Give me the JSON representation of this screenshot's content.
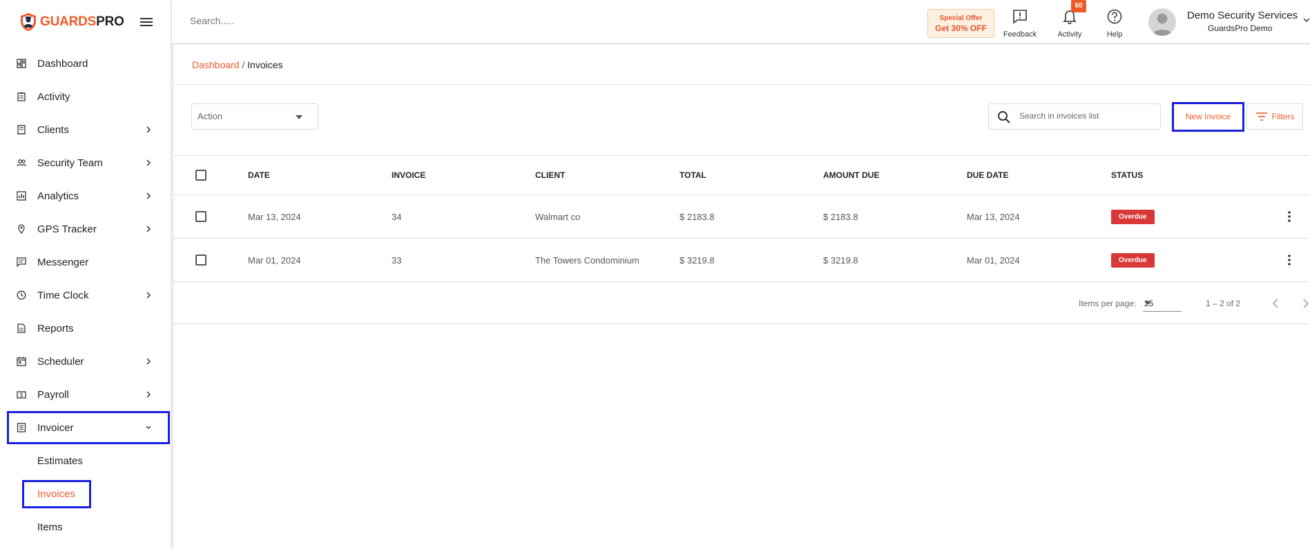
{
  "brand": {
    "part1": "GUARDS",
    "part2": "PRO"
  },
  "header": {
    "search_placeholder": "Search.....",
    "offer_line1": "Special Offer",
    "offer_line2": "Get 30% OFF",
    "feedback_label": "Feedback",
    "activity_label": "Activity",
    "activity_count": "60",
    "help_label": "Help",
    "user_name": "Demo Security Services",
    "user_org": "GuardsPro Demo"
  },
  "sidebar": {
    "items": [
      {
        "label": "Dashboard",
        "icon": "dashboard-icon"
      },
      {
        "label": "Activity",
        "icon": "clipboard-icon"
      },
      {
        "label": "Clients",
        "icon": "building-icon"
      },
      {
        "label": "Security Team",
        "icon": "people-icon"
      },
      {
        "label": "Analytics",
        "icon": "chart-icon"
      },
      {
        "label": "GPS Tracker",
        "icon": "location-icon"
      },
      {
        "label": "Messenger",
        "icon": "chat-icon"
      },
      {
        "label": "Time Clock",
        "icon": "clock-icon"
      },
      {
        "label": "Reports",
        "icon": "document-icon"
      },
      {
        "label": "Scheduler",
        "icon": "calendar-icon"
      },
      {
        "label": "Payroll",
        "icon": "dollar-icon"
      },
      {
        "label": "Invoicer",
        "icon": "invoice-icon"
      }
    ],
    "sub_items": [
      {
        "label": "Estimates"
      },
      {
        "label": "Invoices",
        "active": true
      },
      {
        "label": "Items"
      }
    ]
  },
  "breadcrumb": {
    "root": "Dashboard",
    "separator": " / ",
    "current": "Invoices"
  },
  "toolbar": {
    "action_label": "Action",
    "search_placeholder": "Search in invoices list",
    "new_invoice_label": "New Invoice",
    "filters_label": "Filters"
  },
  "table": {
    "headers": [
      "DATE",
      "INVOICE",
      "CLIENT",
      "TOTAL",
      "AMOUNT DUE",
      "DUE DATE",
      "STATUS"
    ],
    "rows": [
      {
        "date": "Mar 13, 2024",
        "invoice": "34",
        "client": "Walmart co",
        "total": "$ 2183.8",
        "amount_due": "$ 2183.8",
        "due_date": "Mar 13, 2024",
        "status": "Overdue"
      },
      {
        "date": "Mar 01, 2024",
        "invoice": "33",
        "client": "The Towers Condominium",
        "total": "$ 3219.8",
        "amount_due": "$ 3219.8",
        "due_date": "Mar 01, 2024",
        "status": "Overdue"
      }
    ]
  },
  "pagination": {
    "items_per_page_label": "Items per page:",
    "items_per_page_value": "25",
    "range_label": "1 – 2 of 2"
  },
  "colors": {
    "accent": "#f05a28",
    "highlight": "#1a1ee0",
    "overdue": "#d93838"
  }
}
